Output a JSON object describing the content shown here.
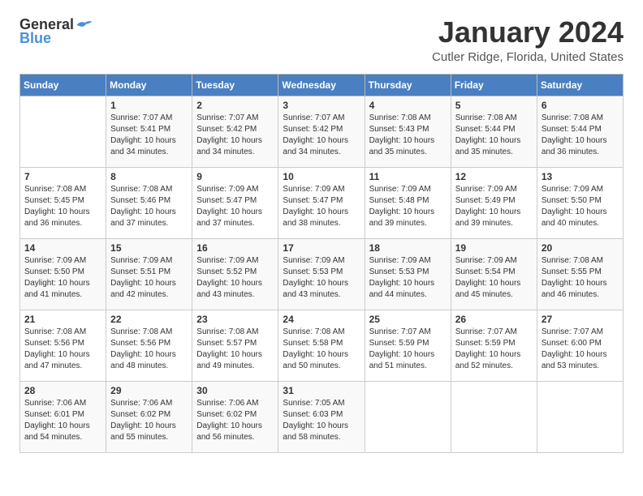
{
  "logo": {
    "text_general": "General",
    "text_blue": "Blue"
  },
  "header": {
    "month_year": "January 2024",
    "location": "Cutler Ridge, Florida, United States"
  },
  "weekdays": [
    "Sunday",
    "Monday",
    "Tuesday",
    "Wednesday",
    "Thursday",
    "Friday",
    "Saturday"
  ],
  "weeks": [
    [
      {
        "day": "",
        "sunrise": "",
        "sunset": "",
        "daylight": ""
      },
      {
        "day": "1",
        "sunrise": "Sunrise: 7:07 AM",
        "sunset": "Sunset: 5:41 PM",
        "daylight": "Daylight: 10 hours and 34 minutes."
      },
      {
        "day": "2",
        "sunrise": "Sunrise: 7:07 AM",
        "sunset": "Sunset: 5:42 PM",
        "daylight": "Daylight: 10 hours and 34 minutes."
      },
      {
        "day": "3",
        "sunrise": "Sunrise: 7:07 AM",
        "sunset": "Sunset: 5:42 PM",
        "daylight": "Daylight: 10 hours and 34 minutes."
      },
      {
        "day": "4",
        "sunrise": "Sunrise: 7:08 AM",
        "sunset": "Sunset: 5:43 PM",
        "daylight": "Daylight: 10 hours and 35 minutes."
      },
      {
        "day": "5",
        "sunrise": "Sunrise: 7:08 AM",
        "sunset": "Sunset: 5:44 PM",
        "daylight": "Daylight: 10 hours and 35 minutes."
      },
      {
        "day": "6",
        "sunrise": "Sunrise: 7:08 AM",
        "sunset": "Sunset: 5:44 PM",
        "daylight": "Daylight: 10 hours and 36 minutes."
      }
    ],
    [
      {
        "day": "7",
        "sunrise": "Sunrise: 7:08 AM",
        "sunset": "Sunset: 5:45 PM",
        "daylight": "Daylight: 10 hours and 36 minutes."
      },
      {
        "day": "8",
        "sunrise": "Sunrise: 7:08 AM",
        "sunset": "Sunset: 5:46 PM",
        "daylight": "Daylight: 10 hours and 37 minutes."
      },
      {
        "day": "9",
        "sunrise": "Sunrise: 7:09 AM",
        "sunset": "Sunset: 5:47 PM",
        "daylight": "Daylight: 10 hours and 37 minutes."
      },
      {
        "day": "10",
        "sunrise": "Sunrise: 7:09 AM",
        "sunset": "Sunset: 5:47 PM",
        "daylight": "Daylight: 10 hours and 38 minutes."
      },
      {
        "day": "11",
        "sunrise": "Sunrise: 7:09 AM",
        "sunset": "Sunset: 5:48 PM",
        "daylight": "Daylight: 10 hours and 39 minutes."
      },
      {
        "day": "12",
        "sunrise": "Sunrise: 7:09 AM",
        "sunset": "Sunset: 5:49 PM",
        "daylight": "Daylight: 10 hours and 39 minutes."
      },
      {
        "day": "13",
        "sunrise": "Sunrise: 7:09 AM",
        "sunset": "Sunset: 5:50 PM",
        "daylight": "Daylight: 10 hours and 40 minutes."
      }
    ],
    [
      {
        "day": "14",
        "sunrise": "Sunrise: 7:09 AM",
        "sunset": "Sunset: 5:50 PM",
        "daylight": "Daylight: 10 hours and 41 minutes."
      },
      {
        "day": "15",
        "sunrise": "Sunrise: 7:09 AM",
        "sunset": "Sunset: 5:51 PM",
        "daylight": "Daylight: 10 hours and 42 minutes."
      },
      {
        "day": "16",
        "sunrise": "Sunrise: 7:09 AM",
        "sunset": "Sunset: 5:52 PM",
        "daylight": "Daylight: 10 hours and 43 minutes."
      },
      {
        "day": "17",
        "sunrise": "Sunrise: 7:09 AM",
        "sunset": "Sunset: 5:53 PM",
        "daylight": "Daylight: 10 hours and 43 minutes."
      },
      {
        "day": "18",
        "sunrise": "Sunrise: 7:09 AM",
        "sunset": "Sunset: 5:53 PM",
        "daylight": "Daylight: 10 hours and 44 minutes."
      },
      {
        "day": "19",
        "sunrise": "Sunrise: 7:09 AM",
        "sunset": "Sunset: 5:54 PM",
        "daylight": "Daylight: 10 hours and 45 minutes."
      },
      {
        "day": "20",
        "sunrise": "Sunrise: 7:08 AM",
        "sunset": "Sunset: 5:55 PM",
        "daylight": "Daylight: 10 hours and 46 minutes."
      }
    ],
    [
      {
        "day": "21",
        "sunrise": "Sunrise: 7:08 AM",
        "sunset": "Sunset: 5:56 PM",
        "daylight": "Daylight: 10 hours and 47 minutes."
      },
      {
        "day": "22",
        "sunrise": "Sunrise: 7:08 AM",
        "sunset": "Sunset: 5:56 PM",
        "daylight": "Daylight: 10 hours and 48 minutes."
      },
      {
        "day": "23",
        "sunrise": "Sunrise: 7:08 AM",
        "sunset": "Sunset: 5:57 PM",
        "daylight": "Daylight: 10 hours and 49 minutes."
      },
      {
        "day": "24",
        "sunrise": "Sunrise: 7:08 AM",
        "sunset": "Sunset: 5:58 PM",
        "daylight": "Daylight: 10 hours and 50 minutes."
      },
      {
        "day": "25",
        "sunrise": "Sunrise: 7:07 AM",
        "sunset": "Sunset: 5:59 PM",
        "daylight": "Daylight: 10 hours and 51 minutes."
      },
      {
        "day": "26",
        "sunrise": "Sunrise: 7:07 AM",
        "sunset": "Sunset: 5:59 PM",
        "daylight": "Daylight: 10 hours and 52 minutes."
      },
      {
        "day": "27",
        "sunrise": "Sunrise: 7:07 AM",
        "sunset": "Sunset: 6:00 PM",
        "daylight": "Daylight: 10 hours and 53 minutes."
      }
    ],
    [
      {
        "day": "28",
        "sunrise": "Sunrise: 7:06 AM",
        "sunset": "Sunset: 6:01 PM",
        "daylight": "Daylight: 10 hours and 54 minutes."
      },
      {
        "day": "29",
        "sunrise": "Sunrise: 7:06 AM",
        "sunset": "Sunset: 6:02 PM",
        "daylight": "Daylight: 10 hours and 55 minutes."
      },
      {
        "day": "30",
        "sunrise": "Sunrise: 7:06 AM",
        "sunset": "Sunset: 6:02 PM",
        "daylight": "Daylight: 10 hours and 56 minutes."
      },
      {
        "day": "31",
        "sunrise": "Sunrise: 7:05 AM",
        "sunset": "Sunset: 6:03 PM",
        "daylight": "Daylight: 10 hours and 58 minutes."
      },
      {
        "day": "",
        "sunrise": "",
        "sunset": "",
        "daylight": ""
      },
      {
        "day": "",
        "sunrise": "",
        "sunset": "",
        "daylight": ""
      },
      {
        "day": "",
        "sunrise": "",
        "sunset": "",
        "daylight": ""
      }
    ]
  ]
}
